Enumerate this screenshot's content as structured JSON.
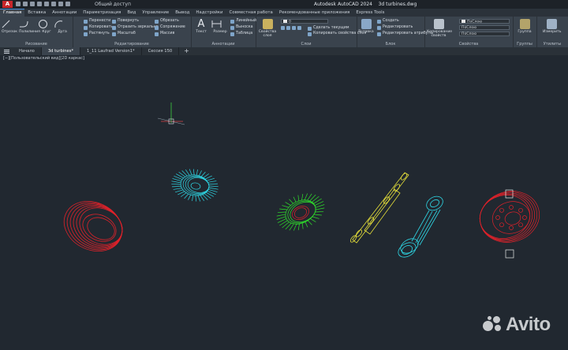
{
  "app": {
    "logo_letter": "A",
    "share_label": "Общий доступ",
    "window_title": "Autodesk AutoCAD 2024    3d turbines.dwg"
  },
  "ribbon_tabs": [
    "Главная",
    "Вставка",
    "Аннотации",
    "Параметризация",
    "Вид",
    "Управление",
    "Вывод",
    "Надстройки",
    "Совместная работа",
    "Рекомендованные приложения",
    "Express Tools"
  ],
  "ribbon": {
    "draw": {
      "title": "Рисование",
      "line": "Отрезок",
      "polyline": "Полилиния",
      "circle": "Круг",
      "arc": "Дуга"
    },
    "modify": {
      "title": "Редактирование",
      "move": "Перенести",
      "copy": "Копировать",
      "stretch": "Растянуть",
      "rotate": "Повернуть",
      "mirror": "Отразить зеркально",
      "scale": "Масштаб",
      "trim": "Обрезать",
      "fillet": "Сопряжение",
      "array": "Массив"
    },
    "annotation": {
      "title": "Аннотации",
      "text": "Текст",
      "dimension": "Размер",
      "linear": "Линейный",
      "leader": "Выноска",
      "table": "Таблица"
    },
    "layers": {
      "title": "Слои",
      "layer_properties": "Свойства слоя",
      "current_layer": "0",
      "make_current": "Сделать текущим",
      "match_layer": "Копировать свойства слоя"
    },
    "block": {
      "title": "Блок",
      "insert": "Вставка",
      "create": "Создать",
      "edit": "Редактировать",
      "edit_attributes": "Редактировать атрибуты"
    },
    "properties": {
      "title": "Свойства",
      "match": "Копирование свойств",
      "color": "ПоСлою",
      "linetype": "ПоСлою",
      "lineweight": "ПоСлою"
    },
    "groups": {
      "title": "Группы",
      "label": "Группа"
    },
    "utilities": {
      "title": "Утилиты",
      "label": "Измерить"
    }
  },
  "doc_tabs": [
    "Начало",
    "3d turbines*",
    "1_11 Laufrad Version1*",
    "Сессия 150",
    "+"
  ],
  "viewport": {
    "label": "[−][Пользовательский вид][2D каркас]"
  },
  "colors": {
    "red": "#e0222a",
    "cyan": "#2ed8e6",
    "green": "#2fe02b",
    "yellow": "#e8e23a",
    "accent": "#4b8fd6"
  },
  "watermark": {
    "text": "Avito"
  }
}
